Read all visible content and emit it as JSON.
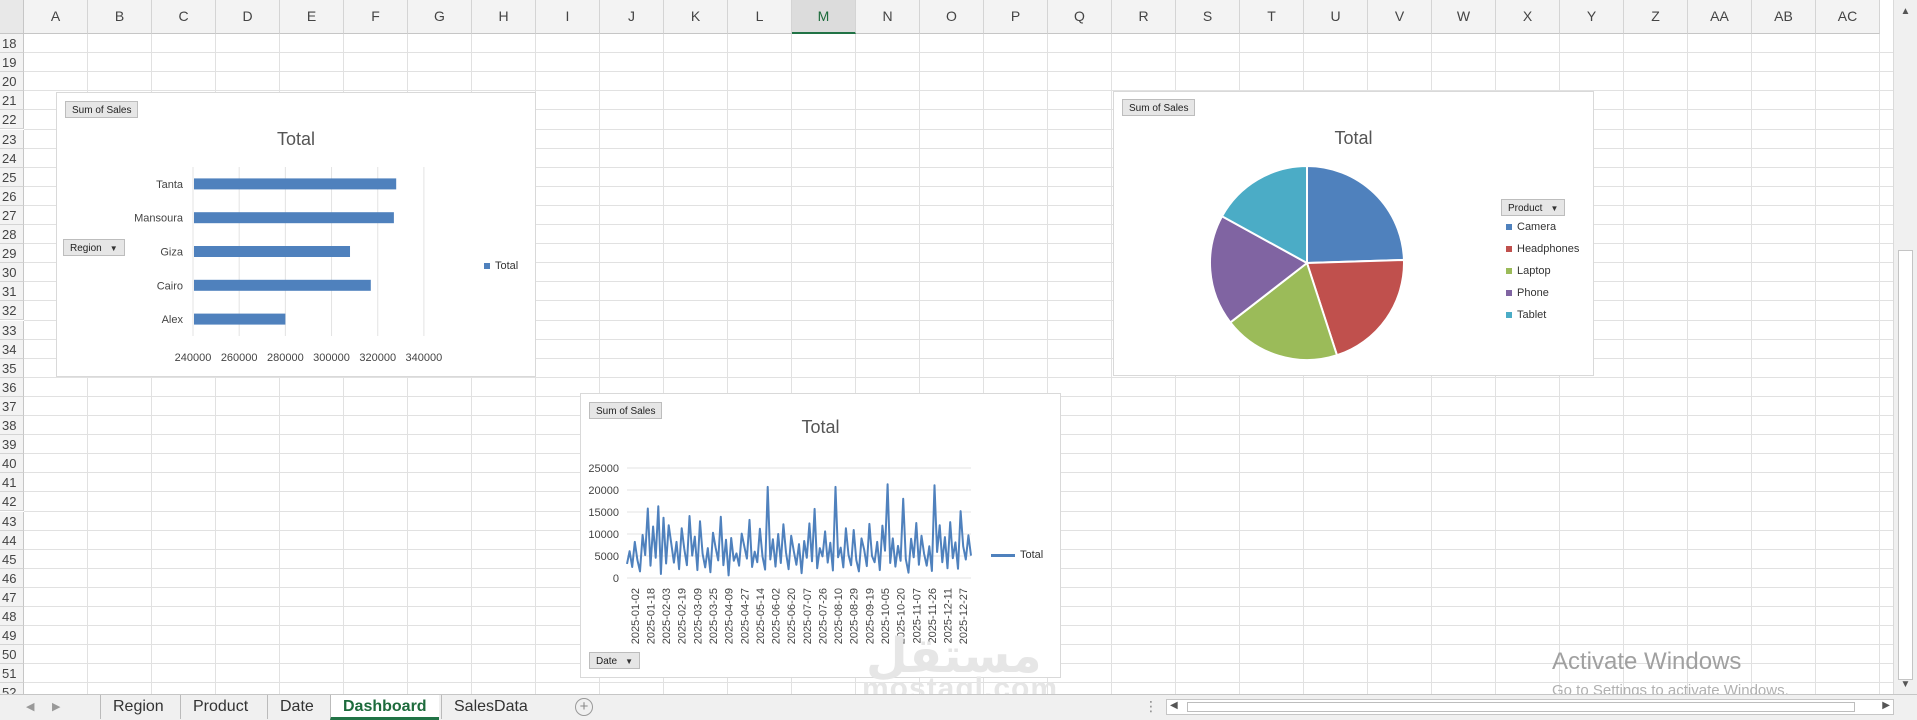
{
  "columns": [
    "A",
    "B",
    "C",
    "D",
    "E",
    "F",
    "G",
    "H",
    "I",
    "J",
    "K",
    "L",
    "M",
    "N",
    "O",
    "P",
    "Q",
    "R",
    "S",
    "T",
    "U",
    "V",
    "W",
    "X",
    "Y",
    "Z",
    "AA",
    "AB",
    "AC"
  ],
  "selected_column": "M",
  "rows": [
    "18",
    "19",
    "20",
    "21",
    "22",
    "23",
    "24",
    "25",
    "26",
    "27",
    "28",
    "29",
    "30",
    "31",
    "32",
    "33",
    "34",
    "35",
    "36",
    "37",
    "38",
    "39",
    "40",
    "41",
    "42",
    "43",
    "44",
    "45",
    "46",
    "47",
    "48",
    "49",
    "50",
    "51",
    "52"
  ],
  "charts": {
    "region": {
      "field_button": "Sum of Sales",
      "axis_button": "Region",
      "title": "Total",
      "legend": "Total"
    },
    "product": {
      "field_button": "Sum of Sales",
      "legend_button": "Product",
      "title": "Total"
    },
    "date": {
      "field_button": "Sum of Sales",
      "axis_button": "Date",
      "title": "Total",
      "legend": "Total"
    }
  },
  "chart_data": [
    {
      "type": "bar",
      "orientation": "horizontal",
      "title": "Total",
      "categories": [
        "Tanta",
        "Mansoura",
        "Giza",
        "Cairo",
        "Alex"
      ],
      "series": [
        {
          "name": "Total",
          "values": [
            328000,
            327000,
            308000,
            317000,
            280000
          ]
        }
      ],
      "xlim": [
        240000,
        350000
      ],
      "xticks": [
        "240000",
        "260000",
        "280000",
        "300000",
        "320000",
        "340000"
      ],
      "legend_position": "right",
      "color": "#4f81bd"
    },
    {
      "type": "pie",
      "title": "Total",
      "categories": [
        "Camera",
        "Headphones",
        "Laptop",
        "Phone",
        "Tablet"
      ],
      "values": [
        24.5,
        20.5,
        19.5,
        18.5,
        17
      ],
      "colors": [
        "#4f81bd",
        "#c0504d",
        "#9bbb59",
        "#8064a2",
        "#4bacc6"
      ],
      "legend_position": "right"
    },
    {
      "type": "line",
      "title": "Total",
      "ylim": [
        0,
        25000
      ],
      "yticks": [
        "0",
        "5000",
        "10000",
        "15000",
        "20000",
        "25000"
      ],
      "xticks": [
        "2025-01-02",
        "2025-01-18",
        "2025-02-03",
        "2025-02-19",
        "2025-03-09",
        "2025-03-25",
        "2025-04-09",
        "2025-04-27",
        "2025-05-14",
        "2025-06-02",
        "2025-06-20",
        "2025-07-07",
        "2025-07-26",
        "2025-08-10",
        "2025-08-29",
        "2025-09-19",
        "2025-10-05",
        "2025-10-20",
        "2025-11-07",
        "2025-11-26",
        "2025-12-11",
        "2025-12-27"
      ],
      "series": [
        {
          "name": "Total",
          "values": [
            3200,
            6100,
            2500,
            8200,
            4100,
            1500,
            9800,
            5200,
            15800,
            2800,
            11700,
            4600,
            16300,
            900,
            13700,
            3300,
            12000,
            7800,
            3500,
            8200,
            2000,
            11300,
            6600,
            2900,
            14100,
            5100,
            9400,
            1800,
            12900,
            5500,
            2400,
            6800,
            1300,
            10300,
            6900,
            4000,
            13900,
            2900,
            8700,
            600,
            9100,
            3900,
            5600,
            2800,
            10100,
            7200,
            4400,
            13200,
            2500,
            6000,
            3600,
            11200,
            4900,
            1900,
            20700,
            4200,
            8800,
            2600,
            10000,
            3400,
            12200,
            5800,
            2000,
            9600,
            6100,
            3000,
            7700,
            1100,
            8400,
            4600,
            12400,
            3800,
            15700,
            2200,
            6800,
            4900,
            10600,
            3500,
            8000,
            1700,
            20700,
            4700,
            6900,
            2400,
            11300,
            5300,
            2900,
            10900,
            4100,
            1500,
            9000,
            6400,
            2700,
            12300,
            5000,
            3600,
            8200,
            1800,
            11900,
            6200,
            21300,
            3400,
            9000,
            2600,
            7300,
            3900,
            18000,
            4300,
            1200,
            8900,
            4700,
            12500,
            3000,
            9600,
            5500,
            2800,
            7200,
            1600,
            21100,
            5900,
            12000,
            3600,
            9300,
            2200,
            12700,
            4500,
            8100,
            2100,
            15200,
            7200,
            4200,
            9700,
            5100
          ]
        }
      ],
      "legend_position": "right",
      "color": "#4f81bd"
    }
  ],
  "sheet_tabs": [
    "Region",
    "Product",
    "Date",
    "Dashboard",
    "SalesData"
  ],
  "active_tab": "Dashboard",
  "watermark": {
    "title": "Activate Windows",
    "subtitle": "Go to Settings to activate Windows.",
    "logo_ar": "مستقل",
    "logo_en": "mostaql.com"
  }
}
